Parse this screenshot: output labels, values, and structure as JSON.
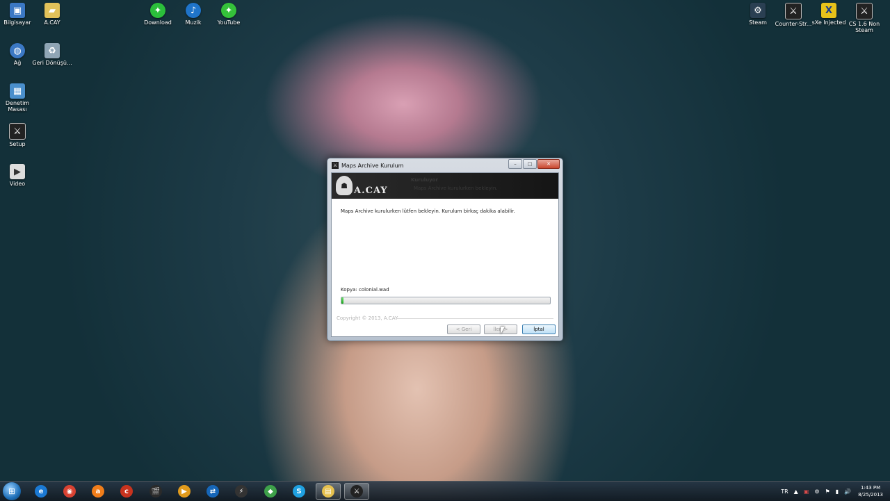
{
  "desktop_icons": [
    {
      "label": "Bilgisayar",
      "icon": "computer-icon",
      "color": "#3b78c4"
    },
    {
      "label": "A.CAY",
      "icon": "folder-icon",
      "color": "#e2c25a"
    },
    {
      "label": "Download",
      "icon": "razer-download-icon",
      "color": "#2bbf3b"
    },
    {
      "label": "Muzik",
      "icon": "music-player-icon",
      "color": "#1f74c9"
    },
    {
      "label": "YouTube",
      "icon": "razer-youtube-icon",
      "color": "#35c13a"
    },
    {
      "label": "Ağ",
      "icon": "network-icon",
      "color": "#3b78c4"
    },
    {
      "label": "Geri Dönüşü...",
      "icon": "recycle-bin-icon",
      "color": "#8fa5b5"
    },
    {
      "label": "Denetim Masası",
      "icon": "control-panel-icon",
      "color": "#4a8fcc"
    },
    {
      "label": "Setup",
      "icon": "counter-strike-setup-icon",
      "color": "#222222"
    },
    {
      "label": "Video",
      "icon": "video-file-icon",
      "color": "#dddddd"
    },
    {
      "label": "Steam",
      "icon": "steam-icon",
      "color": "#2a3f52"
    },
    {
      "label": "Counter-Str...",
      "icon": "counter-strike-icon",
      "color": "#222222"
    },
    {
      "label": "sXe Injected",
      "icon": "sxe-injected-icon",
      "color": "#e8c21a"
    },
    {
      "label": "CS 1.6 Non Steam",
      "icon": "cs16-icon",
      "color": "#222222"
    }
  ],
  "dialog": {
    "title": "Maps Archive Kurulum",
    "brand": "A.CAY",
    "header_title": "Kuruluyor",
    "header_subtitle": "Maps Archive kurulurken bekleyin.",
    "message": "Maps Archive kurulurken lütfen bekleyin. Kurulum birkaç dakika alabilir.",
    "status": "Kopya: colonial.wad",
    "progress": 0.01,
    "copyright": "Copyright © 2013, A.CAY",
    "back_label": "< Geri",
    "next_label": "İleri >",
    "cancel_label": "İptal"
  },
  "taskbar": {
    "items": [
      {
        "icon": "internet-explorer-icon",
        "color": "#1b79d3",
        "glyph": "e"
      },
      {
        "icon": "chrome-icon",
        "color": "#d94232",
        "glyph": "◉"
      },
      {
        "icon": "avast-icon",
        "color": "#f07d1a",
        "glyph": "a"
      },
      {
        "icon": "ccleaner-icon",
        "color": "#c8331e",
        "glyph": "c"
      },
      {
        "icon": "movie-maker-icon",
        "color": "#2a2a2a",
        "glyph": "🎬"
      },
      {
        "icon": "media-player-icon",
        "color": "#e29b1c",
        "glyph": "▶"
      },
      {
        "icon": "teamviewer-icon",
        "color": "#1666b8",
        "glyph": "⇄"
      },
      {
        "icon": "winamp-icon",
        "color": "#333333",
        "glyph": "⚡"
      },
      {
        "icon": "app-icon",
        "color": "#3ea14a",
        "glyph": "◆"
      },
      {
        "icon": "skype-icon",
        "color": "#1fa0e0",
        "glyph": "S"
      },
      {
        "icon": "explorer-icon",
        "color": "#e6c14f",
        "glyph": "▤"
      },
      {
        "icon": "setup-icon",
        "color": "#222222",
        "glyph": "⚔"
      }
    ],
    "language": "TR",
    "time": "1:43 PM",
    "date": "8/25/2013"
  }
}
